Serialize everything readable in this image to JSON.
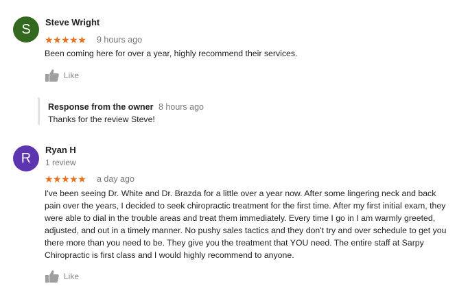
{
  "reviews": [
    {
      "avatar_letter": "S",
      "avatar_color": "#33691e",
      "name": "Steve Wright",
      "stars": "★★★★★",
      "time": "9 hours ago",
      "text": "Been coming here for over a year, highly recommend their services.",
      "like_label": "Like",
      "response": {
        "label": "Response from the owner",
        "time": "8 hours ago",
        "text": "Thanks for the review Steve!"
      }
    },
    {
      "avatar_letter": "R",
      "avatar_color": "#5e35b1",
      "name": "Ryan H",
      "review_count": "1 review",
      "stars": "★★★★★",
      "time": "a day ago",
      "text": "I've been seeing Dr. White and Dr. Brazda for a little over a year now. After some lingering neck and back pain over the years, I decided to seek chiropractic treatment for the first time. After my first initial exam, they were able to dial in the trouble areas and treat them immediately. Every time I go in I am warmly greeted, adjusted, and out in a timely manner. No pushy sales tactics and they don't try and over schedule to get you there more than you need to be. They give you the treatment that YOU need. The entire staff at Sarpy Chiropractic is first class and I would highly recommend to anyone.",
      "like_label": "Like"
    }
  ],
  "colors": {
    "star": "#e7711b",
    "muted": "#777777",
    "thumb": "#9e9e9e"
  },
  "icons": {
    "like": "thumbs-up-icon",
    "star": "star-icon"
  }
}
